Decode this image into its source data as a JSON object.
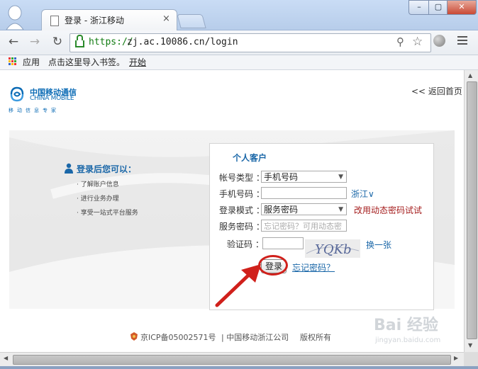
{
  "browser": {
    "tab_title": "登录 - 浙江移动",
    "tab_close": "×",
    "url_scheme": "https://",
    "url_rest": "zj.ac.10086.cn/login",
    "window_buttons": {
      "minimize": "–",
      "maximize": "▢",
      "close": "✕"
    },
    "nav": {
      "back": "←",
      "forward": "→",
      "reload": "↻"
    }
  },
  "bookmarks": {
    "apps": "应用",
    "import": "点击这里导入书签。",
    "start": "开始"
  },
  "header": {
    "logo_cn": "中国移动通信",
    "logo_en": "CHINA MOBILE",
    "logo_tagline": "移动信息专家",
    "home_link": "<< 返回首页"
  },
  "benefits": {
    "title": "登录后您可以：",
    "items": [
      "· 了解账户信息",
      "· 进行业务办理",
      "· 享受一站式平台服务"
    ]
  },
  "login_panel": {
    "title": "个人客户",
    "account_type_label": "帐号类型 ：",
    "account_type_value": "手机号码",
    "phone_label": "手机号码 ：",
    "phone_value": "",
    "region_link": "浙江∨",
    "login_mode_label": "登录模式 ：",
    "login_mode_value": "服务密码",
    "dynamic_link": "改用动态密码试试",
    "password_label": "服务密码 ：",
    "password_placeholder": "忘记密码？可用动态密",
    "captcha_label": "验证码 ：",
    "captcha_text": "YQKb",
    "swap_captcha": "换一张",
    "login_button": "登录",
    "forgot_link": "忘记密码？"
  },
  "footer": {
    "icp": "京ICP备05002571号",
    "company": "| 中国移动浙江公司",
    "rights": "版权所有"
  },
  "watermark": {
    "text": "Bai 经验",
    "sub": "jingyan.baidu.com"
  },
  "colors": {
    "brand_blue": "#1a67a8",
    "highlight_red": "#d0201b",
    "link_red": "#a51d1d"
  }
}
